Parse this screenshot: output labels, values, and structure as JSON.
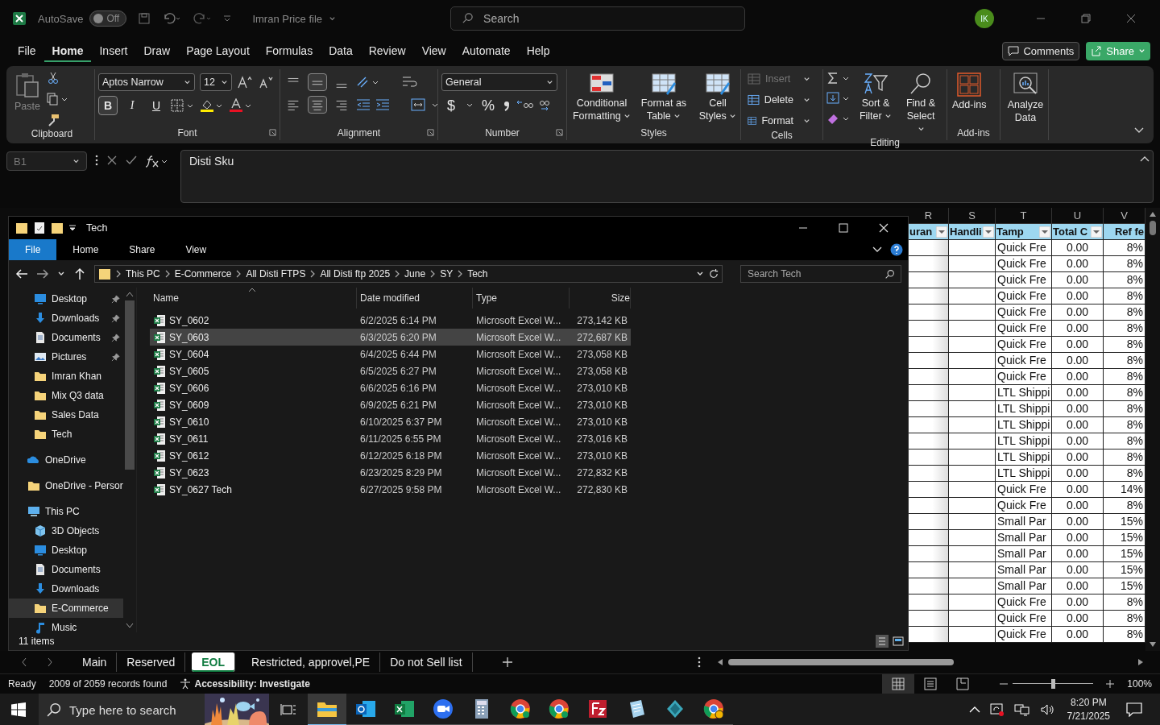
{
  "title_bar": {
    "autosave_label": "AutoSave",
    "autosave_on": false,
    "autosave_state": "Off",
    "file_name": "Imran Price file",
    "search_placeholder": "Search",
    "avatar_initials": "IK"
  },
  "menu_tabs": [
    {
      "label": "File",
      "selected": false
    },
    {
      "label": "Home",
      "selected": true
    },
    {
      "label": "Insert",
      "selected": false
    },
    {
      "label": "Draw",
      "selected": false
    },
    {
      "label": "Page Layout",
      "selected": false
    },
    {
      "label": "Formulas",
      "selected": false
    },
    {
      "label": "Data",
      "selected": false
    },
    {
      "label": "Review",
      "selected": false
    },
    {
      "label": "View",
      "selected": false
    },
    {
      "label": "Automate",
      "selected": false
    },
    {
      "label": "Help",
      "selected": false
    }
  ],
  "comments_label": "Comments",
  "share_label": "Share",
  "ribbon": {
    "clipboard": {
      "paste": "Paste",
      "label": "Clipboard"
    },
    "font": {
      "name": "Aptos Narrow",
      "size": "12",
      "bold": "B",
      "bold_on": true,
      "italic": "I",
      "underline": "U",
      "label": "Font"
    },
    "alignment": {
      "vertical": [
        {
          "kind": "top",
          "selected": false
        },
        {
          "kind": "middle",
          "selected": true
        },
        {
          "kind": "bottom",
          "selected": false
        }
      ],
      "horizontal": [
        {
          "kind": "left",
          "selected": false
        },
        {
          "kind": "center",
          "selected": true
        },
        {
          "kind": "right",
          "selected": false
        }
      ],
      "label": "Alignment"
    },
    "number": {
      "format": "General",
      "currency": "$",
      "percent": "%",
      "label": "Number"
    },
    "styles": {
      "buttons": [
        {
          "kind": "conditional",
          "label": "Conditional Formatting"
        },
        {
          "kind": "table",
          "label": "Format as Table"
        },
        {
          "kind": "cellstyles",
          "label": "Cell Styles"
        }
      ],
      "label": "Styles"
    },
    "cells": {
      "buttons": [
        {
          "label": "Insert",
          "disabled": true
        },
        {
          "label": "Delete",
          "disabled": false
        },
        {
          "label": "Format",
          "disabled": false
        }
      ],
      "label": "Cells"
    },
    "editing": {
      "buttons": [
        {
          "kind": "sort",
          "label": "Sort & Filter"
        },
        {
          "kind": "find",
          "label": "Find & Select"
        }
      ],
      "label": "Editing"
    },
    "addins": {
      "button": "Add-ins",
      "label": "Add-ins"
    },
    "analysis": {
      "button": "Analyze Data"
    }
  },
  "formula_bar": {
    "name_box": "B1",
    "formula": "Disti Sku"
  },
  "grid": {
    "columns": [
      "R",
      "S",
      "T",
      "U",
      "V"
    ],
    "table_headers": [
      "uran",
      "Handli",
      "Tamp",
      "Total C",
      "Ref fe"
    ],
    "rows": [
      {
        "column_t": "Quick Fre",
        "column_u": "0.00",
        "column_v": "8%"
      },
      {
        "column_t": "Quick Fre",
        "column_u": "0.00",
        "column_v": "8%"
      },
      {
        "column_t": "Quick Fre",
        "column_u": "0.00",
        "column_v": "8%"
      },
      {
        "column_t": "Quick Fre",
        "column_u": "0.00",
        "column_v": "8%"
      },
      {
        "column_t": "Quick Fre",
        "column_u": "0.00",
        "column_v": "8%"
      },
      {
        "column_t": "Quick Fre",
        "column_u": "0.00",
        "column_v": "8%"
      },
      {
        "column_t": "Quick Fre",
        "column_u": "0.00",
        "column_v": "8%"
      },
      {
        "column_t": "Quick Fre",
        "column_u": "0.00",
        "column_v": "8%"
      },
      {
        "column_t": "Quick Fre",
        "column_u": "0.00",
        "column_v": "8%"
      },
      {
        "column_t": "LTL Shippi",
        "column_u": "0.00",
        "column_v": "8%"
      },
      {
        "column_t": "LTL Shippi",
        "column_u": "0.00",
        "column_v": "8%"
      },
      {
        "column_t": "LTL Shippi",
        "column_u": "0.00",
        "column_v": "8%"
      },
      {
        "column_t": "LTL Shippi",
        "column_u": "0.00",
        "column_v": "8%"
      },
      {
        "column_t": "LTL Shippi",
        "column_u": "0.00",
        "column_v": "8%"
      },
      {
        "column_t": "LTL Shippi",
        "column_u": "0.00",
        "column_v": "8%"
      },
      {
        "column_t": "Quick Fre",
        "column_u": "0.00",
        "column_v": "14%"
      },
      {
        "column_t": "Quick Fre",
        "column_u": "0.00",
        "column_v": "8%"
      },
      {
        "column_t": "Small Par",
        "column_u": "0.00",
        "column_v": "15%"
      },
      {
        "column_t": "Small Par",
        "column_u": "0.00",
        "column_v": "15%"
      },
      {
        "column_t": "Small Par",
        "column_u": "0.00",
        "column_v": "15%"
      },
      {
        "column_t": "Small Par",
        "column_u": "0.00",
        "column_v": "15%"
      },
      {
        "column_t": "Small Par",
        "column_u": "0.00",
        "column_v": "15%"
      },
      {
        "column_t": "Quick Fre",
        "column_u": "0.00",
        "column_v": "8%"
      },
      {
        "column_t": "Quick Fre",
        "column_u": "0.00",
        "column_v": "8%"
      },
      {
        "column_t": "Quick Fre",
        "column_u": "0.00",
        "column_v": "8%"
      }
    ]
  },
  "explorer": {
    "title": "Tech",
    "tabs": [
      {
        "label": "File",
        "selected": true
      },
      {
        "label": "Home",
        "selected": false
      },
      {
        "label": "Share",
        "selected": false
      },
      {
        "label": "View",
        "selected": false
      }
    ],
    "breadcrumb": [
      "This PC",
      "E-Commerce",
      "All Disti FTPS",
      "All Disti ftp 2025",
      "June",
      "SY",
      "Tech"
    ],
    "search_placeholder": "Search Tech",
    "quick_access": [
      {
        "label": "Desktop",
        "kind": "desktop",
        "pinned": true
      },
      {
        "label": "Downloads",
        "kind": "downloads",
        "pinned": true
      },
      {
        "label": "Documents",
        "kind": "documents",
        "pinned": true
      },
      {
        "label": "Pictures",
        "kind": "pictures",
        "pinned": true
      },
      {
        "label": "Imran Khan",
        "kind": "folder",
        "pinned": false
      },
      {
        "label": "Mix Q3 data",
        "kind": "folder",
        "pinned": false
      },
      {
        "label": "Sales Data",
        "kind": "folder",
        "pinned": false
      },
      {
        "label": "Tech",
        "kind": "folder",
        "pinned": false
      }
    ],
    "locations": [
      {
        "label": "OneDrive",
        "kind": "onedrive",
        "selected": false
      },
      {
        "label": "OneDrive - Persor",
        "kind": "folder",
        "selected": false
      },
      {
        "label": "This PC",
        "kind": "pc",
        "selected": false,
        "children": [
          {
            "label": "3D Objects",
            "kind": "objects3d",
            "selected": false
          },
          {
            "label": "Desktop",
            "kind": "desktop",
            "selected": false
          },
          {
            "label": "Documents",
            "kind": "documents",
            "selected": false
          },
          {
            "label": "Downloads",
            "kind": "downloads",
            "selected": false
          },
          {
            "label": "E-Commerce",
            "kind": "folder",
            "selected": true
          },
          {
            "label": "Music",
            "kind": "music",
            "selected": false
          }
        ]
      }
    ],
    "columns": [
      "Name",
      "Date modified",
      "Type",
      "Size"
    ],
    "files": [
      {
        "name": "SY_0602",
        "date": "6/2/2025 6:14 PM",
        "type": "Microsoft Excel W...",
        "size": "273,142 KB",
        "selected": false
      },
      {
        "name": "SY_0603",
        "date": "6/3/2025 6:20 PM",
        "type": "Microsoft Excel W...",
        "size": "272,687 KB",
        "selected": true
      },
      {
        "name": "SY_0604",
        "date": "6/4/2025 6:44 PM",
        "type": "Microsoft Excel W...",
        "size": "273,058 KB",
        "selected": false
      },
      {
        "name": "SY_0605",
        "date": "6/5/2025 6:27 PM",
        "type": "Microsoft Excel W...",
        "size": "273,058 KB",
        "selected": false
      },
      {
        "name": "SY_0606",
        "date": "6/6/2025 6:16 PM",
        "type": "Microsoft Excel W...",
        "size": "273,010 KB",
        "selected": false
      },
      {
        "name": "SY_0609",
        "date": "6/9/2025 6:21 PM",
        "type": "Microsoft Excel W...",
        "size": "273,010 KB",
        "selected": false
      },
      {
        "name": "SY_0610",
        "date": "6/10/2025 6:37 PM",
        "type": "Microsoft Excel W...",
        "size": "273,010 KB",
        "selected": false
      },
      {
        "name": "SY_0611",
        "date": "6/11/2025 6:55 PM",
        "type": "Microsoft Excel W...",
        "size": "273,016 KB",
        "selected": false
      },
      {
        "name": "SY_0612",
        "date": "6/12/2025 6:18 PM",
        "type": "Microsoft Excel W...",
        "size": "273,010 KB",
        "selected": false
      },
      {
        "name": "SY_0623",
        "date": "6/23/2025 8:29 PM",
        "type": "Microsoft Excel W...",
        "size": "272,832 KB",
        "selected": false
      },
      {
        "name": "SY_0627 Tech",
        "date": "6/27/2025 9:58 PM",
        "type": "Microsoft Excel W...",
        "size": "272,830 KB",
        "selected": false
      }
    ],
    "item_count": "11 items"
  },
  "sheet_tabs": [
    {
      "label": "Main",
      "selected": false
    },
    {
      "label": "Reserved",
      "selected": false
    },
    {
      "label": "EOL",
      "selected": true
    },
    {
      "label": "Restricted, approvel,PE",
      "selected": false
    },
    {
      "label": "Do not Sell list",
      "selected": false
    }
  ],
  "status_bar": {
    "mode": "Ready",
    "records": "2009 of 2059 records found",
    "accessibility": "Accessibility: Investigate",
    "views": [
      {
        "kind": "normal",
        "selected": true
      },
      {
        "kind": "page_layout",
        "selected": false
      },
      {
        "kind": "page_break",
        "selected": false
      }
    ],
    "zoom": {
      "level": 0.5,
      "reading": "100%"
    }
  },
  "taskbar": {
    "search_placeholder": "Type here to search",
    "apps": [
      {
        "kind": "explorer",
        "active": true
      },
      {
        "kind": "outlook",
        "active": false
      },
      {
        "kind": "excel",
        "active": false
      },
      {
        "kind": "zoom",
        "active": false
      },
      {
        "kind": "calculator",
        "active": false
      },
      {
        "kind": "chrome",
        "active": false
      },
      {
        "kind": "chrome",
        "active": false
      },
      {
        "kind": "filezilla",
        "active": false
      },
      {
        "kind": "notepad",
        "active": false
      },
      {
        "kind": "gem",
        "active": false
      },
      {
        "kind": "chrome_profile",
        "active": false
      }
    ],
    "time": "8:20 PM",
    "date": "7/21/2025"
  }
}
